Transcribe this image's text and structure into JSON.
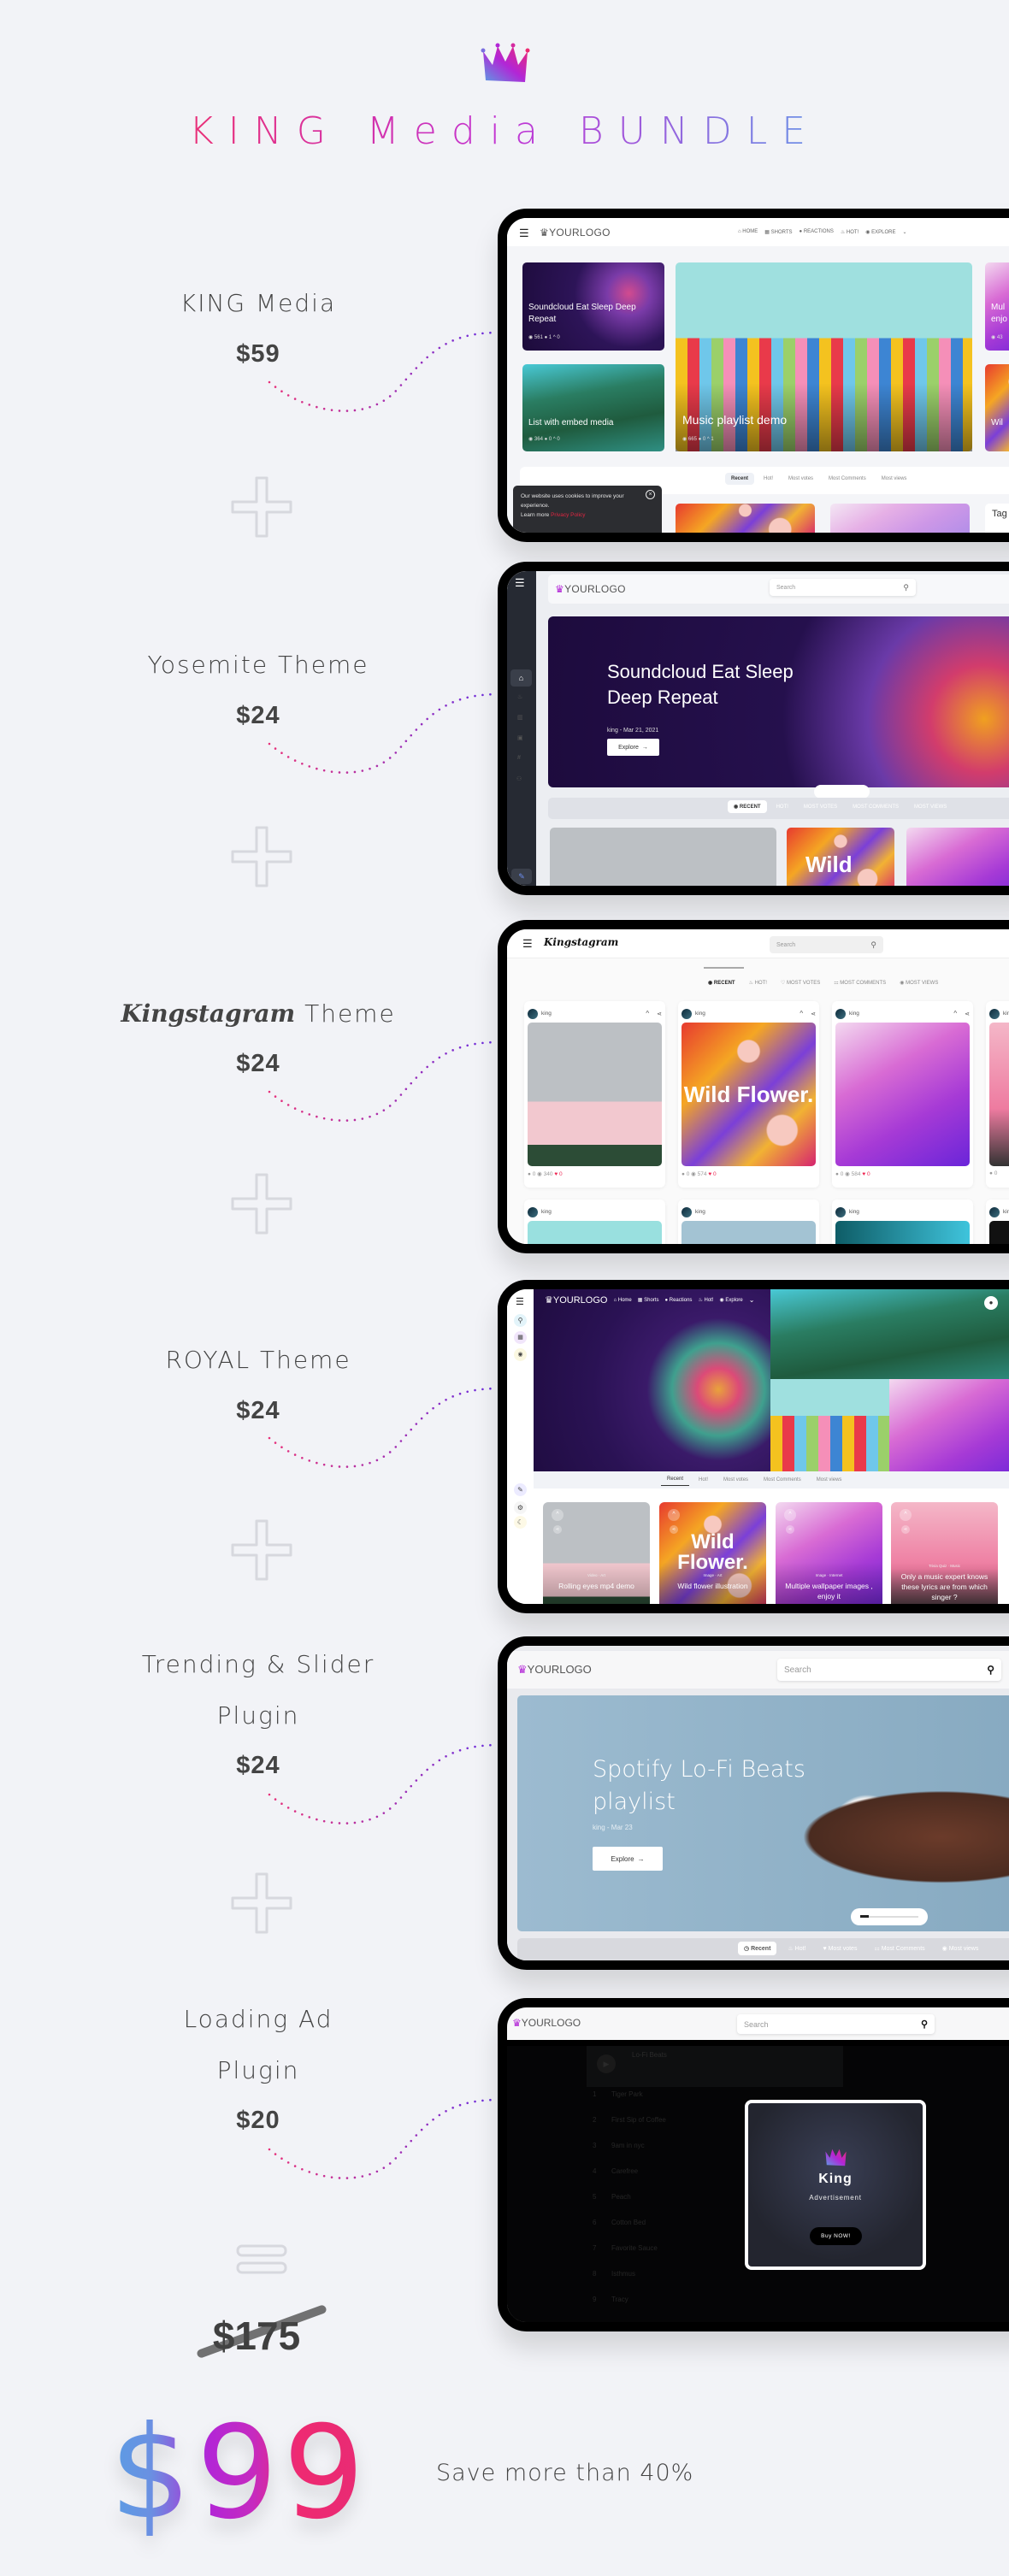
{
  "header": {
    "title": "KING Media BUNDLE",
    "logo_icon": "crown-icon"
  },
  "colors": {
    "gradient_start": "#5b9de4",
    "gradient_mid": "#b226d6",
    "gradient_end": "#ee2a72",
    "background": "#f2f3f7"
  },
  "products": [
    {
      "name": "KING Media",
      "price": "$59"
    },
    {
      "name_script": "",
      "name": "Yosemite Theme",
      "price": "$24"
    },
    {
      "name_script": "Kingstagram",
      "name": " Theme",
      "price": "$24"
    },
    {
      "name": "ROYAL Theme",
      "price": "$24"
    },
    {
      "name_line1": "Trending & Slider",
      "name_line2": "Plugin",
      "price": "$24"
    },
    {
      "name_line1": "Loading Ad",
      "name_line2": "Plugin",
      "price": "$20"
    }
  ],
  "summary": {
    "original_price": "$175",
    "bundle_price": "$99",
    "savings": "Save more than 40%"
  },
  "screens": {
    "king_media": {
      "logo": "YOURLOGO",
      "nav": [
        "HOME",
        "SHORTS",
        "REACTIONS",
        "HOT!",
        "EXPLORE"
      ],
      "cards": [
        {
          "title": "Soundcloud Eat Sleep Deep Repeat",
          "views": "561",
          "comments": "1",
          "votes": "0"
        },
        {
          "title": "List with embed media",
          "views": "364",
          "comments": "0",
          "votes": "0"
        },
        {
          "title": "Music playlist demo",
          "views": "665",
          "comments": "0",
          "votes": "1"
        },
        {
          "title": "Mul enjo",
          "views": "43"
        },
        {
          "title": "Wil"
        }
      ],
      "tabs": [
        "Recent",
        "Hot!",
        "Most votes",
        "Most Comments",
        "Most views"
      ],
      "cookie": {
        "text": "Our website uses cookies to improve your experience.",
        "learn": "Learn more",
        "link": "Privacy Policy"
      },
      "side_title": "Tag"
    },
    "yosemite": {
      "logo": "YOURLOGO",
      "search_placeholder": "Search",
      "hero": {
        "title": "Soundcloud Eat Sleep Deep Repeat",
        "meta": "king - Mar 21, 2021",
        "button": "Explore"
      },
      "tabs": [
        "RECENT",
        "HOT!",
        "MOST VOTES",
        "MOST COMMENTS",
        "MOST VIEWS"
      ],
      "sidebar_icons": [
        "home-icon",
        "fire-icon",
        "chart-icon",
        "image-icon",
        "hash-icon",
        "users-icon",
        "feather-icon"
      ],
      "card_text": "Wild"
    },
    "kingstagram": {
      "logo": "Kingstagram",
      "search_placeholder": "Search",
      "tabs": [
        "RECENT",
        "HOT!",
        "MOST VOTES",
        "MOST COMMENTS",
        "MOST VIEWS"
      ],
      "posts": [
        {
          "user": "king",
          "comments": "0",
          "views": "340",
          "likes": "0"
        },
        {
          "user": "king",
          "comments": "0",
          "views": "574",
          "likes": "0",
          "art": "Wild Flower."
        },
        {
          "user": "king",
          "comments": "0",
          "views": "584",
          "likes": "0"
        },
        {
          "user": "king",
          "comments": "0"
        }
      ],
      "row2_user": "king"
    },
    "royal": {
      "logo": "YOURLOGO",
      "nav": [
        "Home",
        "Shorts",
        "Reactions",
        "Hot!",
        "Explore"
      ],
      "tabs": [
        "Recent",
        "Hot!",
        "Most votes",
        "Most Comments",
        "Most views"
      ],
      "cards": [
        {
          "category": "Video · Art",
          "title": "Rolling eyes mp4 demo"
        },
        {
          "category": "Image · Art",
          "title": "Wild flower illustration",
          "art": "Wild Flower."
        },
        {
          "category": "Image · Internet",
          "title": "Multiple wallpaper images , enjoy it"
        },
        {
          "category": "Trivia Quiz · Music",
          "title": "Only a music expert knows these lyrics are from which singer ?"
        }
      ]
    },
    "trending": {
      "logo": "YOURLOGO",
      "search_placeholder": "Search",
      "hero": {
        "title": "Spotify Lo-Fi Beats playlist",
        "meta": "king - Mar 23",
        "button": "Explore"
      },
      "tabs": [
        "Recent",
        "Hot!",
        "Most votes",
        "Most Comments",
        "Most views"
      ],
      "slider_progress": 0.15
    },
    "loading_ad": {
      "logo": "YOURLOGO",
      "search_placeholder": "Search",
      "playlist": {
        "title": "Lo-Fi Beats",
        "tracks": [
          "Tiger Park",
          "First Sip of Coffee",
          "9am in nyc",
          "Carefree",
          "Peach",
          "Cotton Bed",
          "Favorite Sauce",
          "Isthmus",
          "Tracy"
        ]
      },
      "ad": {
        "brand": "King",
        "label": "Advertisement",
        "button": "Buy NOW!"
      }
    }
  }
}
